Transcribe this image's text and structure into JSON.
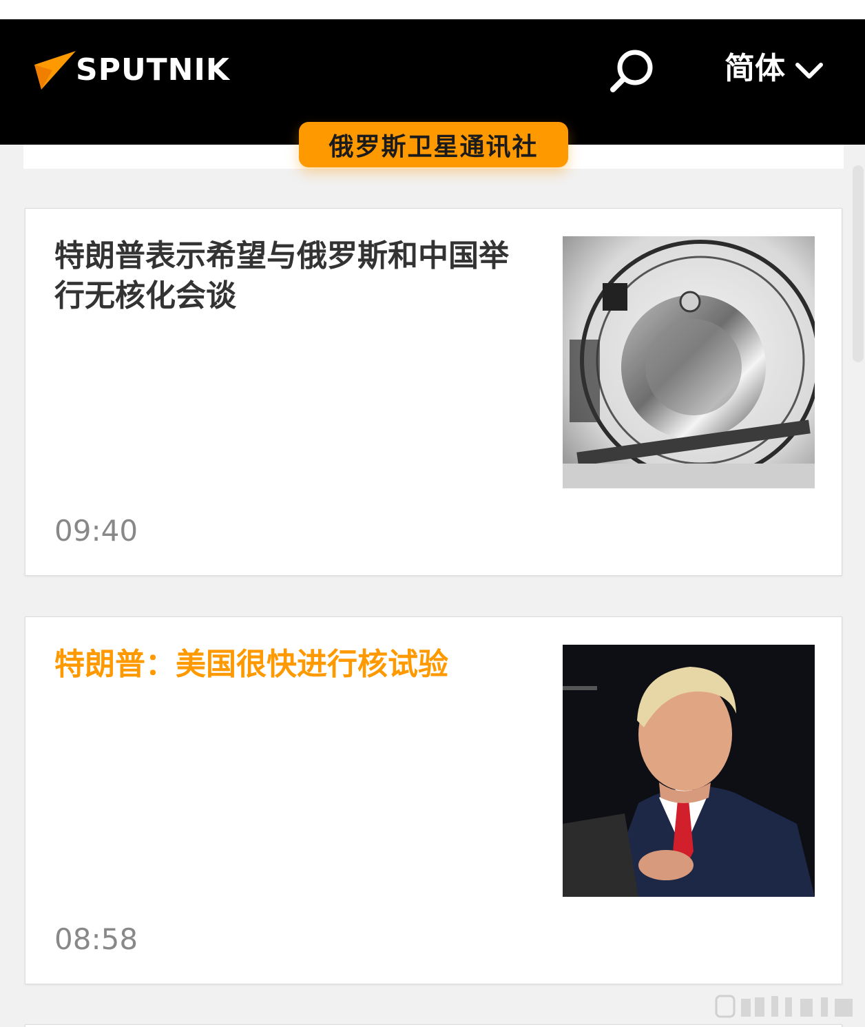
{
  "header": {
    "logo_text": "SPUTNIK",
    "language_label": "简体",
    "brand_colors": {
      "accent": "#ff9900",
      "header_bg": "#000000"
    }
  },
  "brand_badge": "俄罗斯卫星通讯社",
  "articles": [
    {
      "title": "特朗普表示希望与俄罗斯和中国举行无核化会谈",
      "time": "09:40",
      "title_color": "#333333",
      "image_icon": "missile-nosecone-photo"
    },
    {
      "title": "特朗普：美国很快进行核试验",
      "time": "08:58",
      "title_color": "#ff9900",
      "image_icon": "speaker-portrait-photo"
    }
  ]
}
